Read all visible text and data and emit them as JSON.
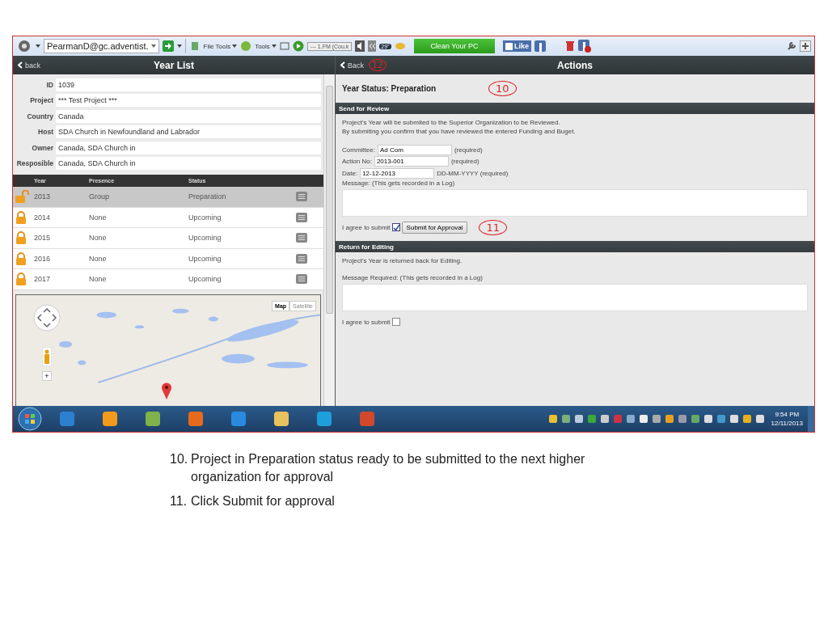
{
  "toolbar": {
    "account": "PearmanD@gc.adventist.",
    "menus": [
      "File Tools",
      "Tools"
    ],
    "radio": "--- 1.FM (Cou.k",
    "weather": "29°",
    "clean_button": "Clean Your PC",
    "like_button": "Like"
  },
  "left_pane": {
    "back": "back",
    "title": "Year List",
    "fields": [
      {
        "label": "ID",
        "value": "1039"
      },
      {
        "label": "Project",
        "value": "*** Test Project ***"
      },
      {
        "label": "Country",
        "value": "Canada"
      },
      {
        "label": "Host",
        "value": "SDA Church in Newfoundland and Labrador"
      },
      {
        "label": "Owner",
        "value": "Canada, SDA Church in"
      },
      {
        "label": "Resposible",
        "value": "Canada, SDA Church in"
      }
    ],
    "table": {
      "columns": [
        "Year",
        "Presence",
        "Status"
      ],
      "rows": [
        {
          "year": "2013",
          "presence": "Group",
          "status": "Preparation",
          "selected": true,
          "locked": false
        },
        {
          "year": "2014",
          "presence": "None",
          "status": "Upcoming",
          "selected": false,
          "locked": true
        },
        {
          "year": "2015",
          "presence": "None",
          "status": "Upcoming",
          "selected": false,
          "locked": true
        },
        {
          "year": "2016",
          "presence": "None",
          "status": "Upcoming",
          "selected": false,
          "locked": true
        },
        {
          "year": "2017",
          "presence": "None",
          "status": "Upcoming",
          "selected": false,
          "locked": true
        }
      ]
    },
    "map": {
      "kind": "picture",
      "map_types": [
        {
          "label": "Map",
          "selected": true
        },
        {
          "label": "Satellite",
          "selected": false
        }
      ],
      "zoom_in": "+"
    }
  },
  "right_pane": {
    "back": "Back",
    "back_mark": "12",
    "title": "Actions",
    "year_status": "Year Status: Preparation",
    "status_mark": "10",
    "send": {
      "heading": "Send for Review",
      "lines": [
        "Project's Year will be submited to the Superior Organization to be Reviewed.",
        "By submiting you confirm that you have reviewed the entered Funding and Buget."
      ],
      "inputs": [
        {
          "label": "Committee:",
          "value": "Ad Com",
          "hint": "(required)"
        },
        {
          "label": "Action No:",
          "value": "2013-001",
          "hint": "(required)"
        },
        {
          "label": "Date:",
          "value": "12-12-2013",
          "hint": "DD-MM-YYYY (required)"
        }
      ],
      "message_label": "Message: (This gets recorded in a Log)",
      "agree": "I agree to submit",
      "checked": true,
      "button": "Submit for Approval",
      "button_mark": "11"
    },
    "ret": {
      "heading": "Return for Editing",
      "line": "Project's Year is returned back for Editing.",
      "message_label": "Message Required: (This gets recorded in a Log)",
      "agree": "I agree to submit",
      "checked": false
    }
  },
  "taskbar": {
    "time": "9:54 PM",
    "date": "12/11/2013"
  },
  "notes": [
    {
      "number": "10.",
      "text": "Project in Preparation status ready to be submitted to the next higher organization for approval"
    },
    {
      "number": "11.",
      "text": "Click Submit for approval"
    }
  ]
}
